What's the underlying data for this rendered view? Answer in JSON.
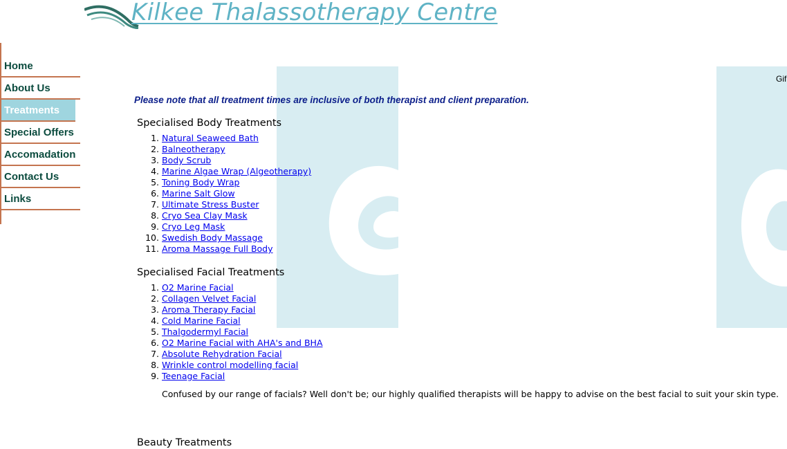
{
  "header": {
    "logo_text": "Kilkee Thalassotherapy Centre"
  },
  "nav": {
    "items": [
      {
        "label": "Home",
        "active": false
      },
      {
        "label": "About Us",
        "active": false
      },
      {
        "label": "Treatments",
        "active": true
      },
      {
        "label": "Special Offers",
        "active": false
      },
      {
        "label": "Accomadation",
        "active": false
      },
      {
        "label": "Contact Us",
        "active": false
      },
      {
        "label": "Links",
        "active": false
      }
    ]
  },
  "top_right_text": "Gif",
  "main": {
    "note": "Please note that all treatment times are inclusive of both therapist and client preparation.",
    "body_section": {
      "title": "Specialised Body Treatments",
      "items": [
        {
          "num": "1.",
          "label": "Natural Seaweed Bath"
        },
        {
          "num": "2.",
          "label": "Balneotherapy"
        },
        {
          "num": "3.",
          "label": "Body Scrub"
        },
        {
          "num": "4.",
          "label": "Marine Algae Wrap (Algeotherapy)"
        },
        {
          "num": "5.",
          "label": "Toning Body Wrap"
        },
        {
          "num": "6.",
          "label": "Marine Salt Glow"
        },
        {
          "num": "7.",
          "label": "Ultimate Stress Buster"
        },
        {
          "num": "8.",
          "label": "Cryo Sea Clay Mask"
        },
        {
          "num": "9.",
          "label": "Cryo Leg Mask"
        },
        {
          "num": "10.",
          "label": "Swedish Body Massage"
        },
        {
          "num": "11.",
          "label": "Aroma Massage Full Body"
        }
      ]
    },
    "facial_section": {
      "title": "Specialised Facial Treatments",
      "items": [
        {
          "num": "1.",
          "label": "O2 Marine Facial"
        },
        {
          "num": "2.",
          "label": "Collagen Velvet Facial"
        },
        {
          "num": "3.",
          "label": "Aroma Therapy Facial"
        },
        {
          "num": "4.",
          "label": "Cold Marine Facial"
        },
        {
          "num": "5.",
          "label": "Thalgodermyl Facial"
        },
        {
          "num": "6.",
          "label": "O2 Marine Facial with AHA's and BHA"
        },
        {
          "num": "7.",
          "label": "Absolute Rehydration Facial"
        },
        {
          "num": "8.",
          "label": "Wrinkle control modelling facial"
        },
        {
          "num": "9.",
          "label": "Teenage Facial"
        }
      ]
    },
    "facial_note": "Confused by our range of facials? Well don't be; our highly qualified therapists will be happy to advise on the best facial to suit your skin type.",
    "beauty_section": {
      "title": "Beauty Treatments"
    }
  },
  "colors": {
    "logo": "#5fb3c5",
    "nav_text": "#0b4b3e",
    "nav_border": "#c4744f",
    "nav_active_bg": "#9fd5df",
    "note_text": "#0b1e8a",
    "link": "#0000ee",
    "watermark": "#d3ebf0"
  }
}
